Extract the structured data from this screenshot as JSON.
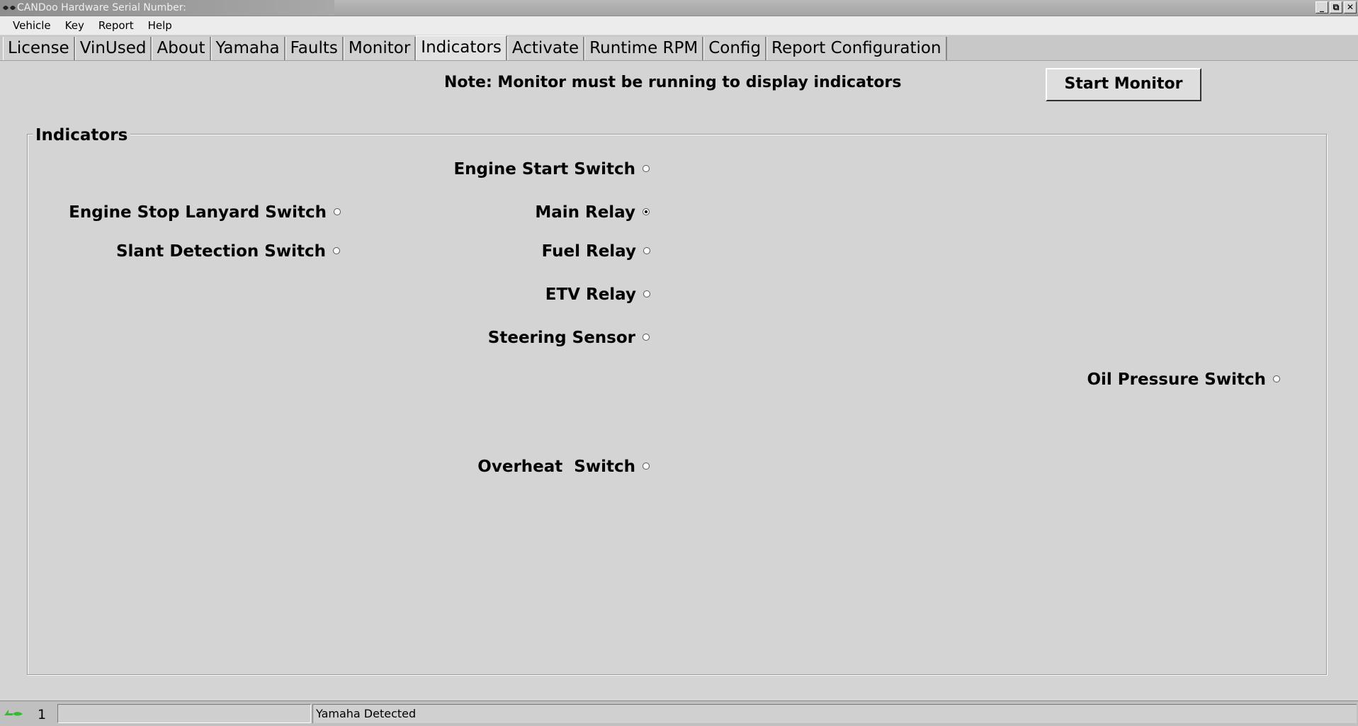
{
  "window": {
    "title": "CANDoo  Hardware Serial Number:",
    "buttons": {
      "minimize": "_",
      "restore": "⧉",
      "close": "✕"
    }
  },
  "menu": [
    "Vehicle",
    "Key",
    "Report",
    "Help"
  ],
  "tabs": [
    "License",
    "VinUsed",
    "About",
    "Yamaha",
    "Faults",
    "Monitor",
    "Indicators",
    "Activate",
    "Runtime RPM",
    "Config",
    "Report Configuration"
  ],
  "active_tab": "Indicators",
  "note": "Note: Monitor must be running to display indicators",
  "start_button": "Start Monitor",
  "group_title": "Indicators",
  "indicators": [
    {
      "label": "Engine Start Switch",
      "on": false
    },
    {
      "label": "Engine Stop Lanyard Switch",
      "on": false
    },
    {
      "label": "Main Relay",
      "on": true
    },
    {
      "label": "Slant Detection Switch",
      "on": false
    },
    {
      "label": "Fuel Relay",
      "on": false
    },
    {
      "label": "ETV Relay",
      "on": false
    },
    {
      "label": "Steering Sensor",
      "on": false
    },
    {
      "label": "Oil Pressure Switch",
      "on": false
    },
    {
      "label": "Overheat  Switch",
      "on": false
    }
  ],
  "status": {
    "number": "1",
    "message": "Yamaha Detected"
  }
}
